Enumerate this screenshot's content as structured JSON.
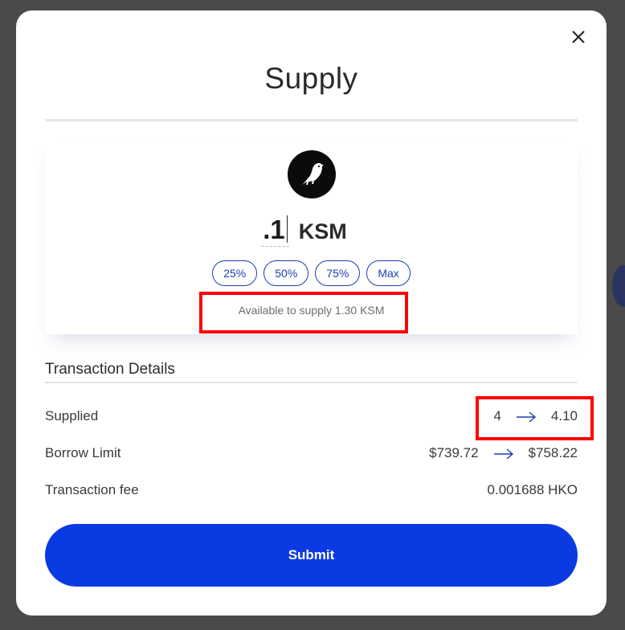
{
  "modal": {
    "title": "Supply",
    "close_icon": "close-icon"
  },
  "token": {
    "logo_icon": "kusama-bird-icon",
    "amount_value": ".1",
    "unit": "KSM"
  },
  "percent_buttons": [
    {
      "label": "25%"
    },
    {
      "label": "50%"
    },
    {
      "label": "75%"
    },
    {
      "label": "Max"
    }
  ],
  "available_text": "Available to supply 1.30 KSM",
  "transaction_details": {
    "title": "Transaction Details",
    "rows": [
      {
        "label": "Supplied",
        "from": "4",
        "to": "4.10"
      },
      {
        "label": "Borrow Limit",
        "from": "$739.72",
        "to": "$758.22"
      },
      {
        "label": "Transaction fee",
        "value": "0.001688 HKO"
      }
    ]
  },
  "submit_label": "Submit",
  "colors": {
    "accent": "#0a3be2",
    "pill_border": "#1e3fae",
    "highlight": "#ff0000",
    "overlay": "#4a4a4a"
  }
}
